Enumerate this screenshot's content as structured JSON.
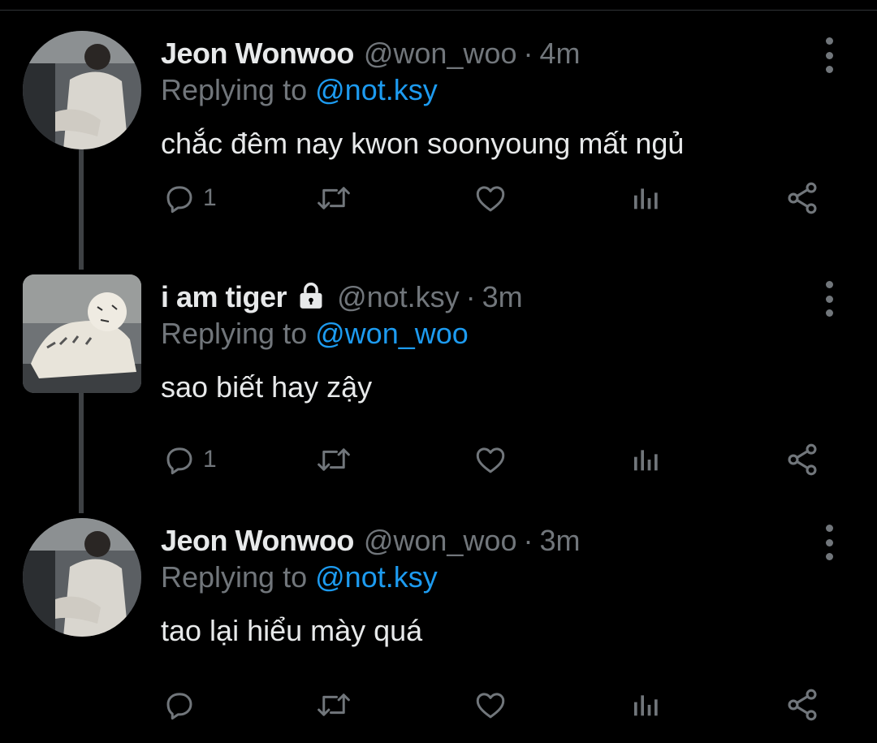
{
  "tweets": [
    {
      "name": "Jeon Wonwoo",
      "handle": "@won_woo",
      "separator": "·",
      "time": "4m",
      "replying_prefix": "Replying to",
      "replying_to": "@not.ksy",
      "text": "chắc đêm nay kwon soonyoung mất ngủ",
      "reply_count": "1",
      "locked": false,
      "avatar": "person-photo"
    },
    {
      "name": "i am tiger",
      "handle": "@not.ksy",
      "separator": "·",
      "time": "3m",
      "replying_prefix": "Replying to",
      "replying_to": "@won_woo",
      "text": "sao biết hay zậy",
      "reply_count": "1",
      "locked": true,
      "avatar": "tiger-photo"
    },
    {
      "name": "Jeon Wonwoo",
      "handle": "@won_woo",
      "separator": "·",
      "time": "3m",
      "replying_prefix": "Replying to",
      "replying_to": "@not.ksy",
      "text": "tao lại hiểu mày quá",
      "reply_count": "",
      "locked": false,
      "avatar": "person-photo"
    }
  ],
  "icons": {
    "reply": "reply-icon",
    "retweet": "retweet-icon",
    "like": "heart-icon",
    "views": "analytics-icon",
    "share": "share-icon",
    "more": "more-vertical-icon",
    "lock": "lock-icon"
  },
  "colors": {
    "background": "#000000",
    "text": "#e7e9ea",
    "muted": "#71767b",
    "accent": "#1d9bf0"
  }
}
